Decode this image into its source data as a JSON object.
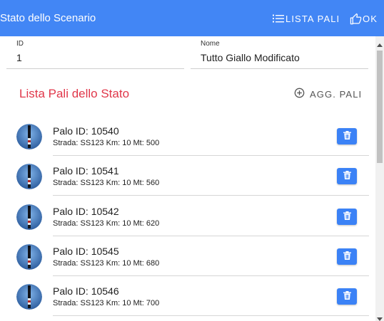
{
  "toolbar": {
    "title": "Stato dello Scenario",
    "lista_pali_label": "LISTA PALI",
    "ok_label": "OK",
    "background_color": "#4286f5"
  },
  "form": {
    "id": {
      "label": "ID",
      "value": "1"
    },
    "nome": {
      "label": "Nome",
      "value": "Tutto Giallo Modificato"
    }
  },
  "section": {
    "title": "Lista Pali dello Stato",
    "add_label": "AGG. PALI",
    "title_color": "#e0374a"
  },
  "pali": [
    {
      "name": "Palo ID: 10540",
      "details": "Strada: SS123 Km: 10 Mt: 500"
    },
    {
      "name": "Palo ID: 10541",
      "details": "Strada: SS123 Km: 10 Mt: 560"
    },
    {
      "name": "Palo ID: 10542",
      "details": "Strada: SS123 Km: 10 Mt: 620"
    },
    {
      "name": "Palo ID: 10545",
      "details": "Strada: SS123 Km: 10 Mt: 680"
    },
    {
      "name": "Palo ID: 10546",
      "details": "Strada: SS123 Km: 10 Mt: 700"
    }
  ],
  "icons": {
    "lista_pali": "list-icon",
    "ok": "thumb-up-icon",
    "add": "add-circle-icon",
    "delete": "trash-icon",
    "avatar": "pole-avatar-icon"
  },
  "colors": {
    "delete_button": "#3b82f6"
  }
}
